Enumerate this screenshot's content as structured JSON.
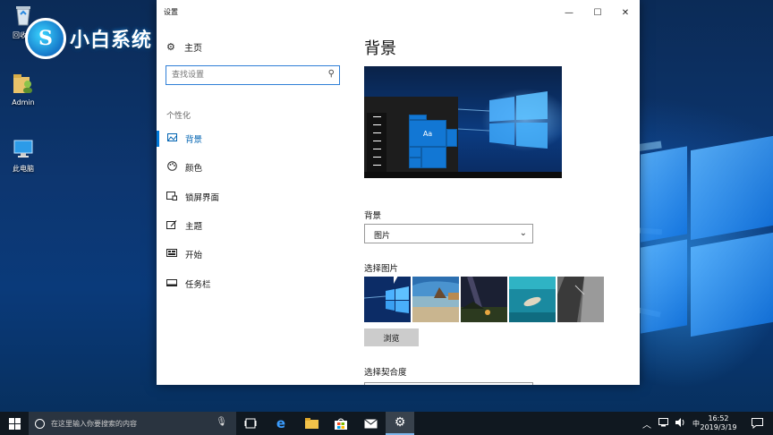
{
  "desktop": {
    "logo_text": "小白系统",
    "logo_glyph": "S",
    "icons": [
      {
        "label": "回收站"
      },
      {
        "label": "Admin"
      },
      {
        "label": "此电脑"
      }
    ]
  },
  "window": {
    "title": "设置",
    "controls": {
      "minimize": "—",
      "maximize": "☐",
      "close": "✕"
    }
  },
  "nav": {
    "home_label": "主页",
    "search_placeholder": "查找设置",
    "section_label": "个性化",
    "items": [
      {
        "label": "背景",
        "icon": "image-icon",
        "active": true
      },
      {
        "label": "颜色",
        "icon": "palette-icon",
        "active": false
      },
      {
        "label": "锁屏界面",
        "icon": "lockscreen-icon",
        "active": false
      },
      {
        "label": "主题",
        "icon": "theme-icon",
        "active": false
      },
      {
        "label": "开始",
        "icon": "start-icon",
        "active": false
      },
      {
        "label": "任务栏",
        "icon": "taskbar-icon",
        "active": false
      }
    ]
  },
  "content": {
    "page_title": "背景",
    "preview_tile_text": "Aa",
    "background_label": "背景",
    "background_value": "图片",
    "choose_picture_label": "选择图片",
    "browse_label": "浏览",
    "fit_label": "选择契合度"
  },
  "taskbar": {
    "search_placeholder": "在这里输入你要搜索的内容",
    "tray_input": "中",
    "time": "16:52",
    "date": "2019/3/19"
  },
  "colors": {
    "accent": "#0078d7",
    "taskbar": "#101820"
  }
}
